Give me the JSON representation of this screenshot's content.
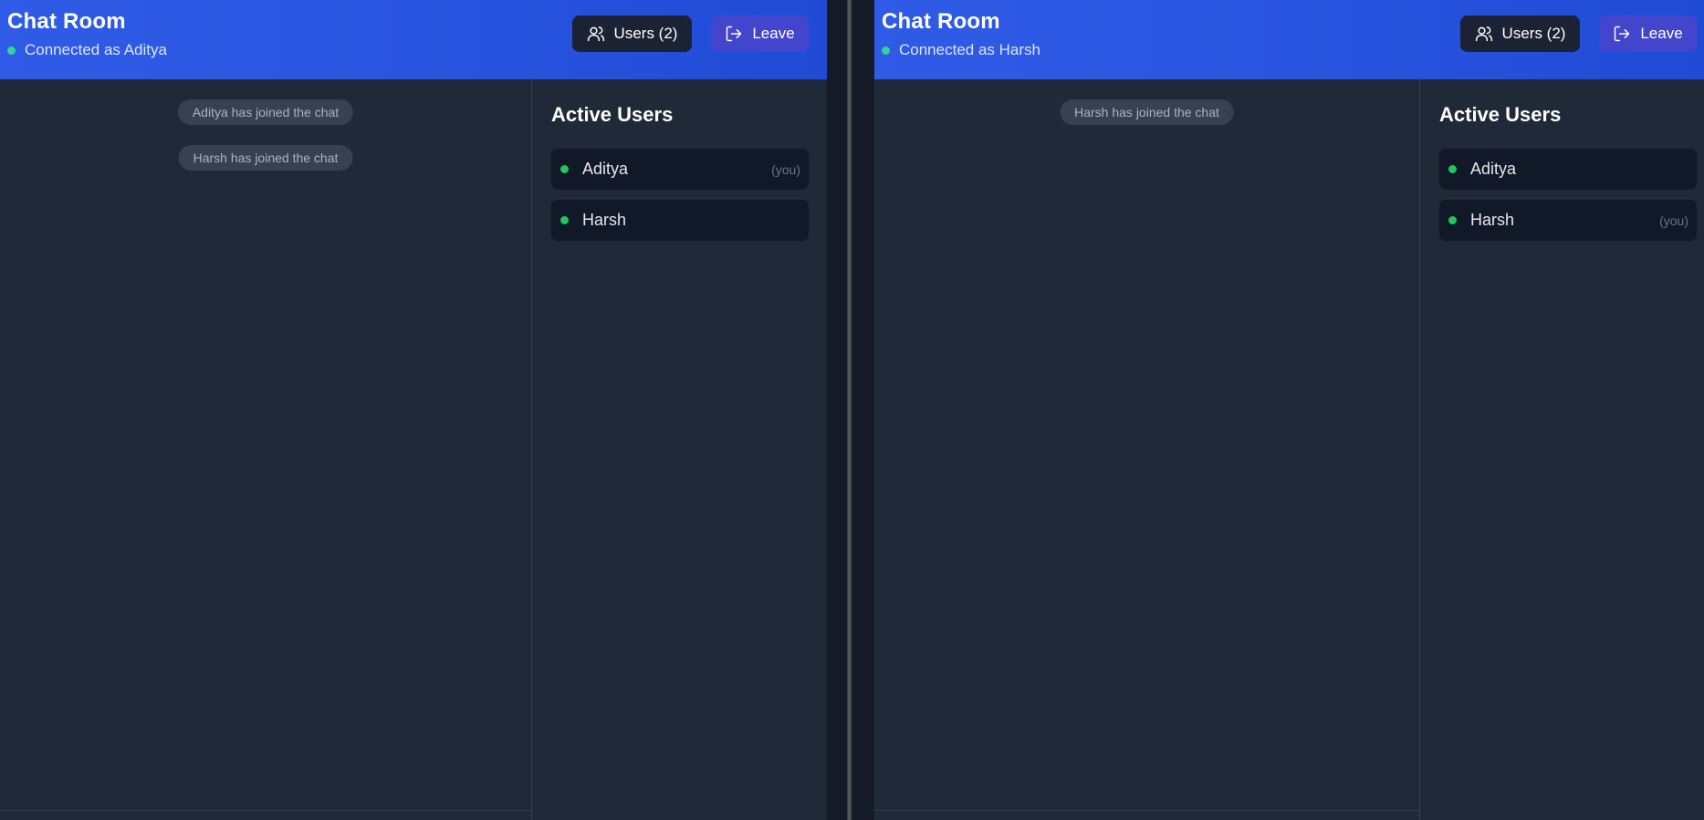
{
  "windows": {
    "left": {
      "header": {
        "title": "Chat Room",
        "status": "Connected as Aditya",
        "users_button": "Users (2)",
        "leave_button": "Leave"
      },
      "messages": [
        "Aditya has joined the chat",
        "Harsh has joined the chat"
      ],
      "sidebar": {
        "title": "Active Users",
        "users": [
          {
            "name": "Aditya",
            "tag": "(you)"
          },
          {
            "name": "Harsh",
            "tag": ""
          }
        ]
      }
    },
    "right": {
      "header": {
        "title": "Chat Room",
        "status": "Connected as Harsh",
        "users_button": "Users (2)",
        "leave_button": "Leave"
      },
      "messages": [
        "Harsh has joined the chat"
      ],
      "sidebar": {
        "title": "Active Users",
        "users": [
          {
            "name": "Aditya",
            "tag": ""
          },
          {
            "name": "Harsh",
            "tag": "(you)"
          }
        ]
      }
    }
  },
  "colors": {
    "header_blue": "#2a55e0",
    "online_green": "#22c55e",
    "leave_button": "#4346cc",
    "panel_bg": "#1f2937"
  },
  "icons": {
    "users_button": "users-icon",
    "leave_button": "logout-icon",
    "status": "online-dot"
  }
}
